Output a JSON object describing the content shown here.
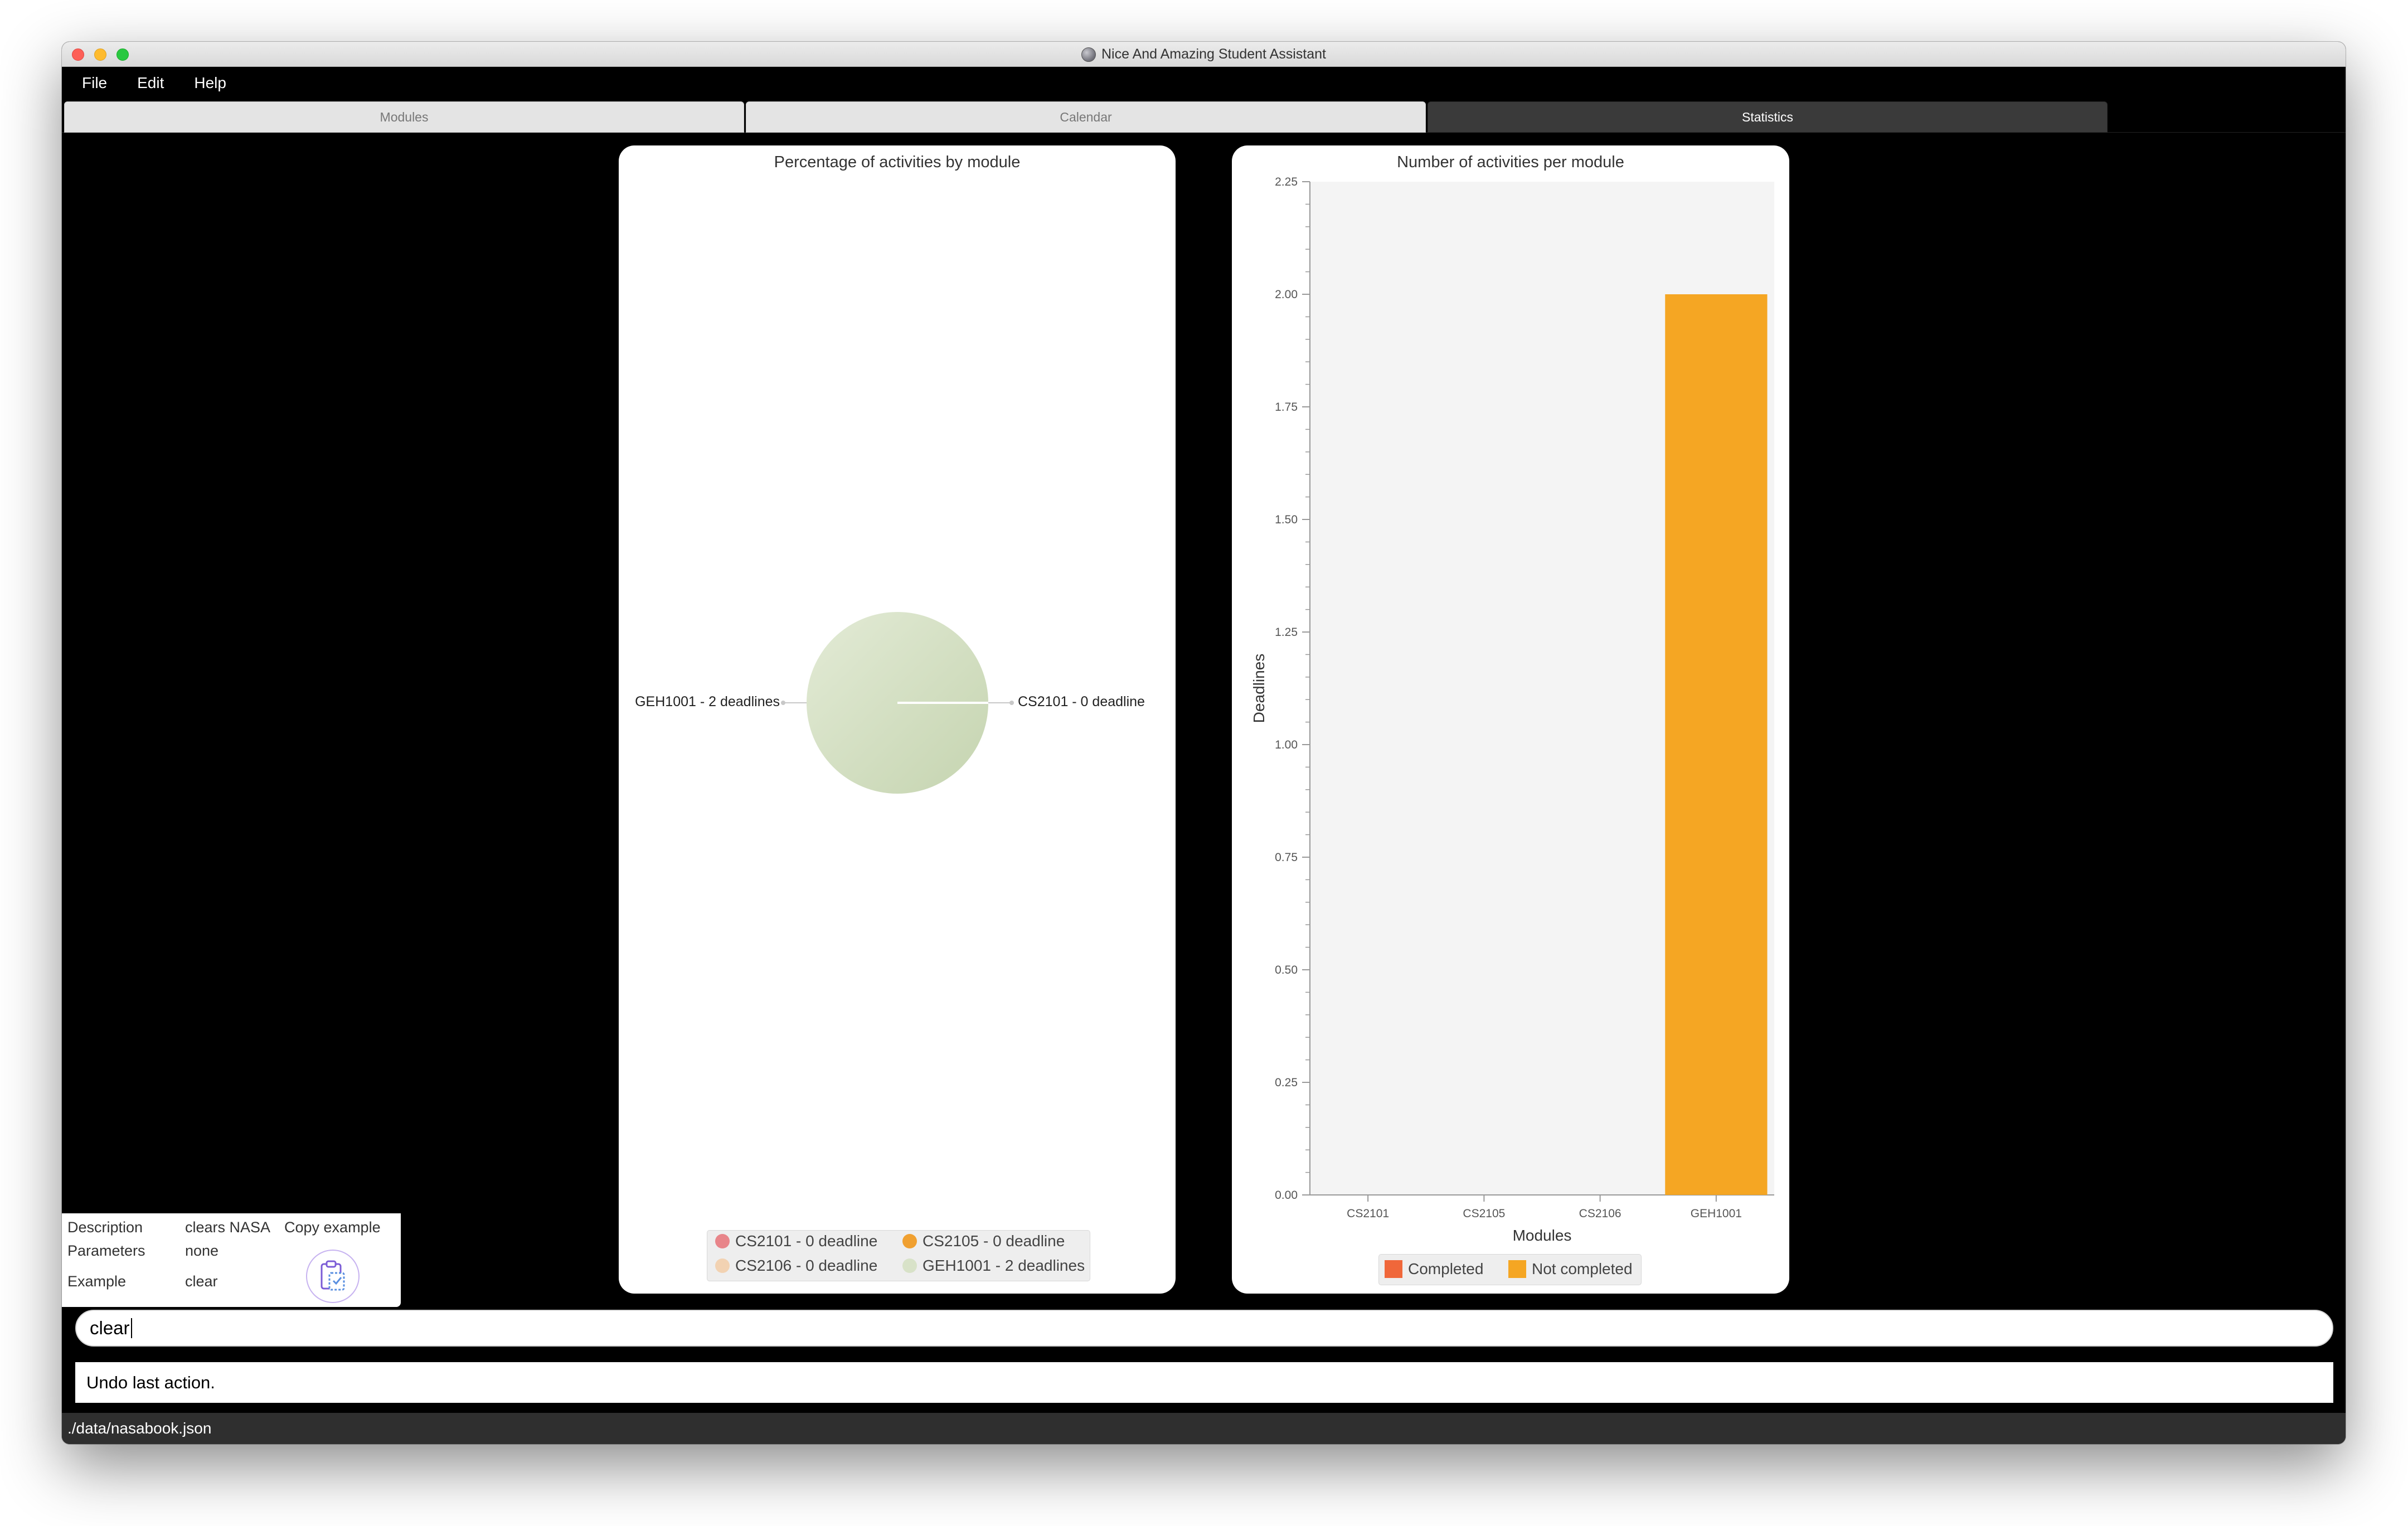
{
  "window": {
    "title": "Nice And Amazing Student Assistant"
  },
  "menu": [
    "File",
    "Edit",
    "Help"
  ],
  "tabs": [
    {
      "label": "Modules",
      "active": false
    },
    {
      "label": "Calendar",
      "active": false
    },
    {
      "label": "Statistics",
      "active": true
    }
  ],
  "pie_panel": {
    "title": "Percentage of activities by module",
    "slice_labels": {
      "left": "GEH1001 - 2 deadlines",
      "right": "CS2101 - 0 deadline"
    },
    "legend": [
      {
        "label": "CS2101 - 0 deadline",
        "color": "#e8858a"
      },
      {
        "label": "CS2105 - 0 deadline",
        "color": "#f0a030"
      },
      {
        "label": "CS2106 - 0 deadline",
        "color": "#f2d2b2"
      },
      {
        "label": "GEH1001 - 2 deadlines",
        "color": "#d8e2c8"
      }
    ]
  },
  "bar_panel": {
    "title": "Number of activities per module",
    "legend": [
      {
        "label": "Completed",
        "color": "#f0673a"
      },
      {
        "label": "Not completed",
        "color": "#f5a623"
      }
    ]
  },
  "chart_data": [
    {
      "type": "pie",
      "title": "Percentage of activities by module",
      "categories": [
        "CS2101 - 0 deadline",
        "CS2105 - 0 deadline",
        "CS2106 - 0 deadline",
        "GEH1001 - 2 deadlines"
      ],
      "values": [
        0,
        0,
        0,
        2
      ]
    },
    {
      "type": "bar",
      "title": "Number of activities per module",
      "categories": [
        "CS2101",
        "CS2105",
        "CS2106",
        "GEH1001"
      ],
      "series": [
        {
          "name": "Completed",
          "values": [
            0,
            0,
            0,
            0
          ]
        },
        {
          "name": "Not completed",
          "values": [
            0,
            0,
            0,
            2
          ]
        }
      ],
      "xlabel": "Modules",
      "ylabel": "Deadlines",
      "ylim": [
        0,
        2.25
      ],
      "yticks": [
        "0.00",
        "0.25",
        "0.50",
        "0.75",
        "1.00",
        "1.25",
        "1.50",
        "1.75",
        "2.00",
        "2.25"
      ],
      "legend_position": "bottom"
    }
  ],
  "help": {
    "description_label": "Description",
    "description_value": "clears NASA",
    "copy_label": "Copy example",
    "parameters_label": "Parameters",
    "parameters_value": "none",
    "example_label": "Example",
    "example_value": "clear",
    "copy_icon": "clipboard-icon"
  },
  "command": {
    "value": "clear"
  },
  "result": {
    "text": "Undo last action."
  },
  "status": {
    "path": "./data/nasabook.json"
  }
}
